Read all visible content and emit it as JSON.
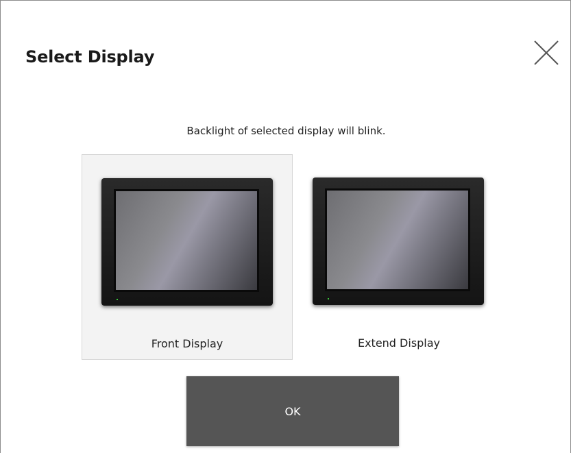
{
  "dialog": {
    "title": "Select Display",
    "close_icon": "close-icon",
    "instruction": "Backlight of selected display will blink.",
    "options": [
      {
        "label": "Front Display",
        "icon": "monitor-icon",
        "selected": true
      },
      {
        "label": "Extend Display",
        "icon": "monitor-icon",
        "selected": false
      }
    ],
    "ok_label": "OK"
  },
  "colors": {
    "ok_button_bg": "#555555",
    "selected_option_bg": "#f3f3f3",
    "led": "#3cc83c"
  }
}
